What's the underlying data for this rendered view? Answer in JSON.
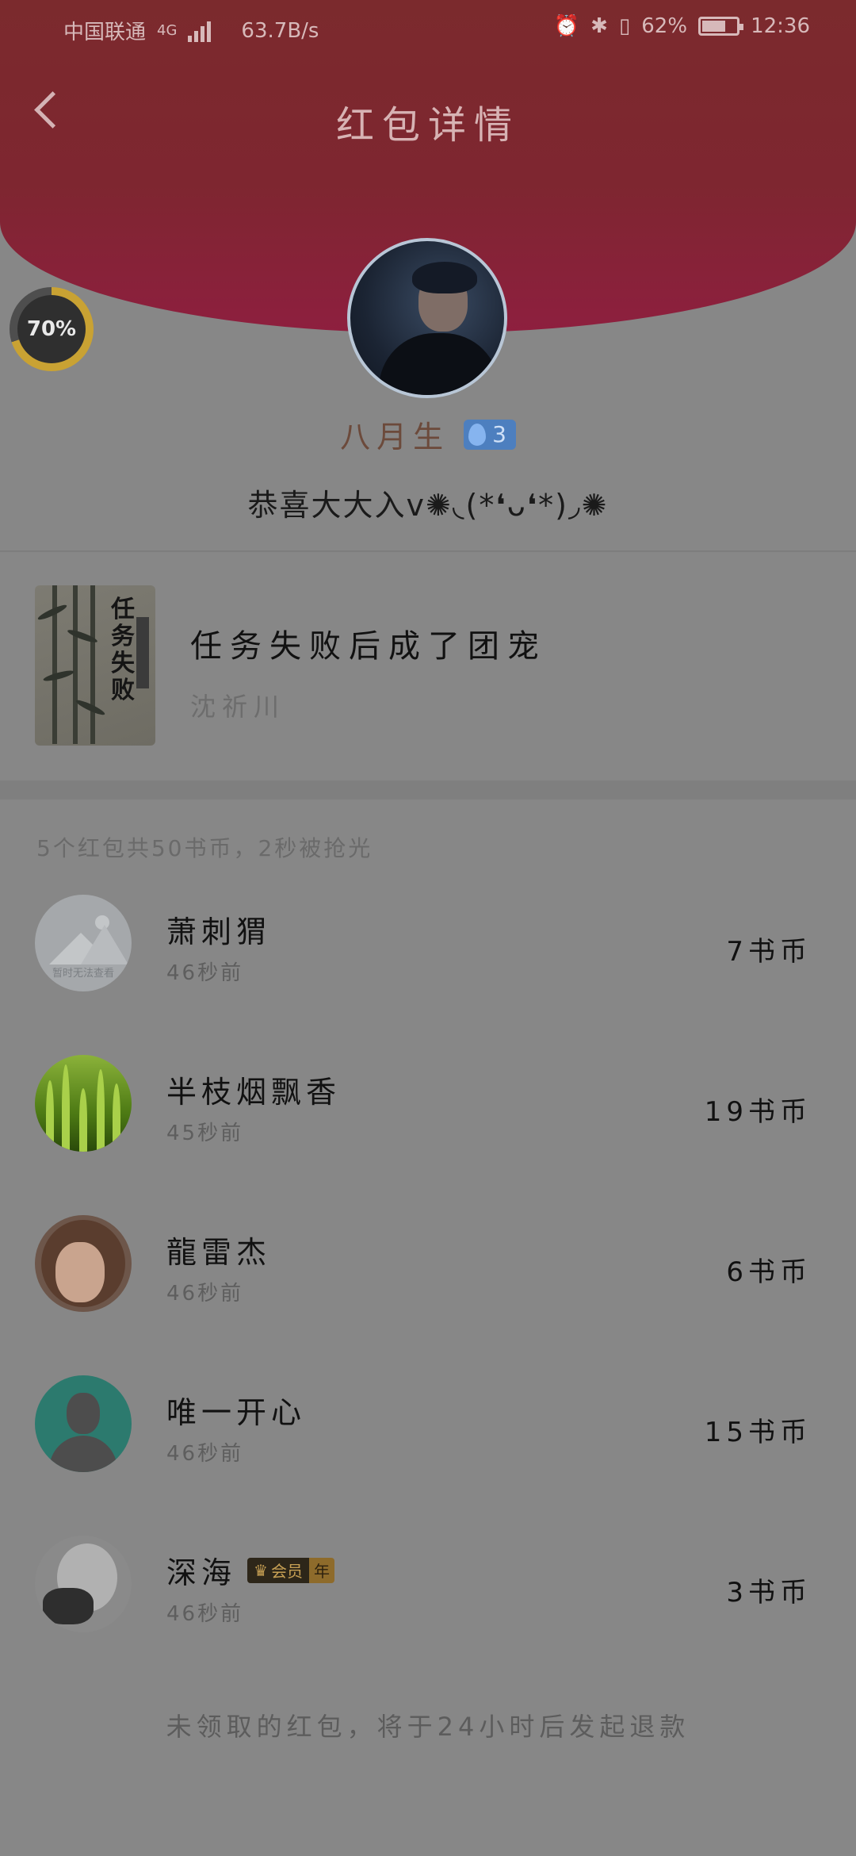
{
  "status_bar": {
    "carrier": "中国联通",
    "network": "4G",
    "speed": "63.7B/s",
    "battery": "62%",
    "time": "12:36"
  },
  "header": {
    "title": "红包详情"
  },
  "progress": {
    "label": "70%",
    "value": 0.7
  },
  "sender": {
    "name": "八月生",
    "level": "3"
  },
  "greeting": "恭喜大大入v✺◟(*❛ᴗ❛*)◞✺",
  "book": {
    "title": "任务失败后成了团宠",
    "author": "沈祈川",
    "cover_title": "任务失败"
  },
  "summary": "5个红包共50书币，2秒被抢光",
  "records": [
    {
      "name": "萧刺猬",
      "time": "46秒前",
      "amount": "7书币",
      "avatar": "placeholder-avatar",
      "avatar_text": "暂时无法查看"
    },
    {
      "name": "半枝烟飘香",
      "time": "45秒前",
      "amount": "19书币",
      "avatar": "grass-avatar"
    },
    {
      "name": "龍雷杰",
      "time": "46秒前",
      "amount": "6书币",
      "avatar": "girl-avatar"
    },
    {
      "name": "唯一开心",
      "time": "46秒前",
      "amount": "15书币",
      "avatar": "default-user-avatar"
    },
    {
      "name": "深海",
      "time": "46秒前",
      "amount": "3书币",
      "avatar": "bird-avatar",
      "badge": "会员",
      "badge_suffix": "年"
    }
  ],
  "footer": "未领取的红包，将于24小时后发起退款",
  "colors": {
    "header": "#7e2630",
    "overlay_bg": "#878787",
    "vip_gold": "#c7a054"
  }
}
